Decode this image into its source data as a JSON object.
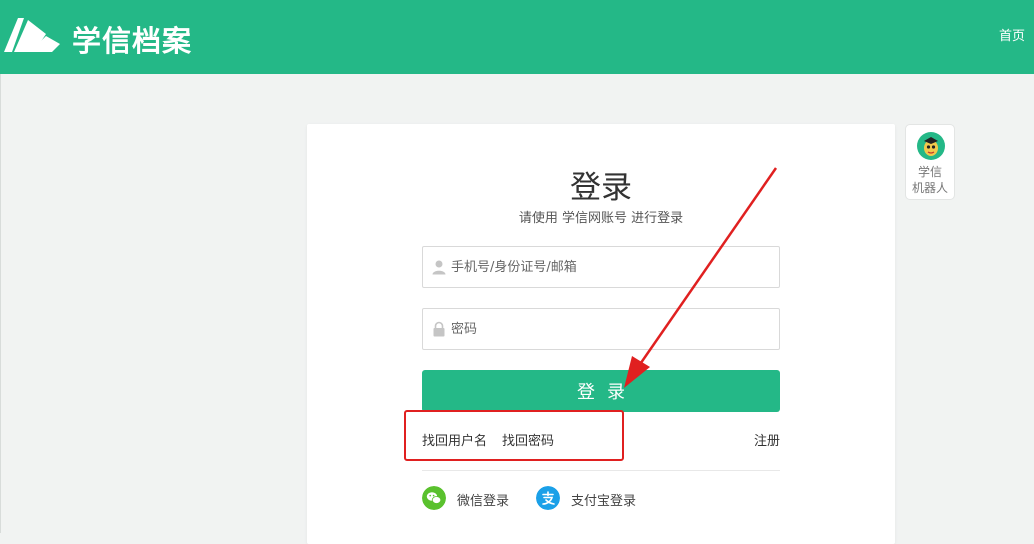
{
  "header": {
    "logo_text": "学信档案",
    "nav_home": "首页"
  },
  "login": {
    "title": "登录",
    "subtitle": "请使用 学信网账号 进行登录",
    "username_placeholder": "手机号/身份证号/邮箱",
    "password_placeholder": "密码",
    "submit_label": "登录",
    "find_username": "找回用户名",
    "find_password": "找回密码",
    "register": "注册",
    "wechat_login": "微信登录",
    "alipay_login": "支付宝登录"
  },
  "robot": {
    "label_line1": "学信",
    "label_line2": "机器人"
  },
  "colors": {
    "brand_green": "#24b887",
    "wechat_green": "#5ac12e",
    "alipay_blue": "#1aa0e8",
    "annotation_red": "#e02020"
  },
  "icons": [
    "logo-icon",
    "user-icon",
    "lock-icon",
    "wechat-icon",
    "alipay-icon",
    "robot-avatar-icon"
  ]
}
